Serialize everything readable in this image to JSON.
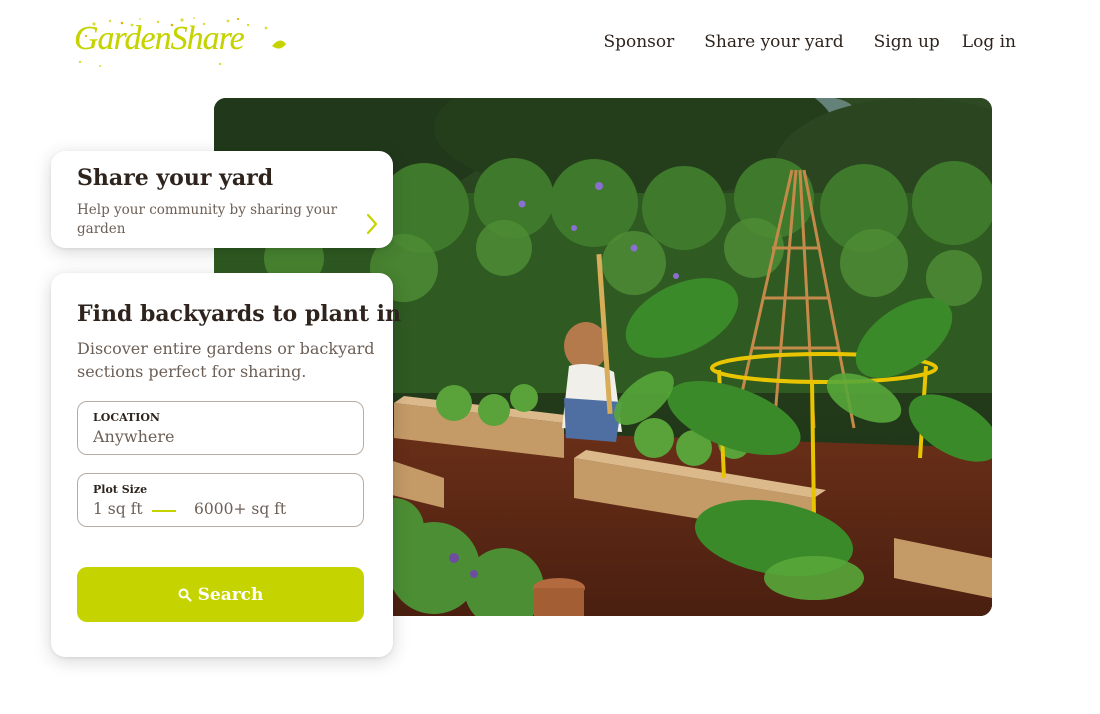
{
  "brand": {
    "name": "GardenShare",
    "accent": "#c5d400",
    "text_color": "#2e241d"
  },
  "nav": {
    "items": [
      "Sponsor",
      "Share your yard",
      "Sign up",
      "Log in"
    ]
  },
  "share_card": {
    "title": "Share your yard",
    "description": "Help your community by sharing your garden",
    "icon": "chevron-right-icon"
  },
  "find_card": {
    "title": "Find backyards to plant in",
    "description": "Discover entire gardens or backyard sections perfect for sharing.",
    "location": {
      "label": "LOCATION",
      "value": "Anywhere"
    },
    "plot_size": {
      "label": "Plot Size",
      "min": "1 sq ft",
      "max": "6000+ sq ft"
    },
    "search_button": {
      "label": "Search",
      "icon": "search-icon"
    }
  },
  "hero": {
    "subject": "garden-photo"
  }
}
